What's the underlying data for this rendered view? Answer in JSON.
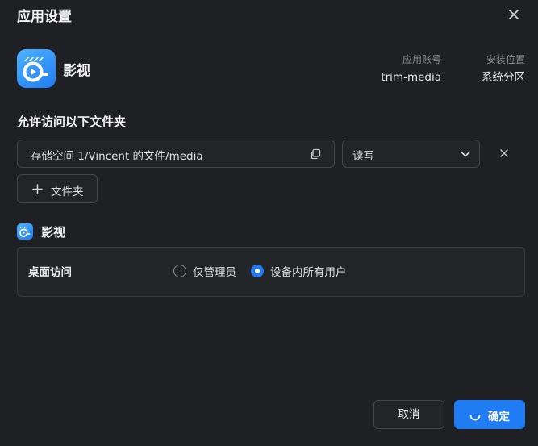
{
  "dialog": {
    "title": "应用设置",
    "close_icon": "close-icon"
  },
  "app": {
    "name": "影视",
    "icon": "film-app-icon",
    "account_label": "应用账号",
    "account_value": "trim-media",
    "location_label": "安装位置",
    "location_value": "系统分区"
  },
  "folders": {
    "section_title": "允许访问以下文件夹",
    "items": [
      {
        "path": "存储空间 1/Vincent 的文件/media",
        "permission": "读写"
      }
    ],
    "add_label": "文件夹"
  },
  "desktop_access": {
    "app_name": "影视",
    "label": "桌面访问",
    "options": [
      {
        "label": "仅管理员",
        "checked": false
      },
      {
        "label": "设备内所有用户",
        "checked": true
      }
    ]
  },
  "footer": {
    "cancel_label": "取消",
    "confirm_label": "确定"
  },
  "colors": {
    "background": "#1f2023",
    "accent": "#1f7cf2",
    "border": "#45464b"
  }
}
